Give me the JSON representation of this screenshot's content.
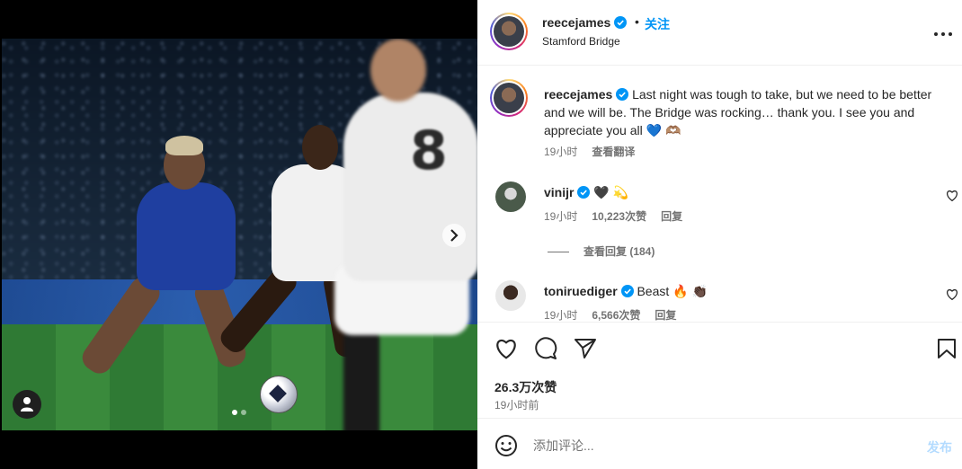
{
  "post": {
    "username": "reecejames",
    "follow_label": "关注",
    "dot": "•",
    "location": "Stamford Bridge"
  },
  "photo": {
    "jersey_number": "8",
    "carousel_current": 1,
    "carousel_total": 2
  },
  "caption": {
    "username": "reecejames",
    "text": "Last night was tough to take, but we need to be better and we will be. The Bridge was rocking… thank you. I see you and appreciate you all 💙 🫶🏽",
    "time": "19小时",
    "translate_label": "查看翻译"
  },
  "comments": [
    {
      "username": "vinijr",
      "text": "🖤 💫",
      "time": "19小时",
      "likes": "10,223次赞",
      "reply_label": "回复",
      "view_replies": "查看回复 (184)"
    },
    {
      "username": "toniruediger",
      "text": "Beast 🔥 👏🏿",
      "time": "19小时",
      "likes": "6,566次赞",
      "reply_label": "回复"
    }
  ],
  "actions": {
    "likes": "26.3万次赞",
    "time": "19小时前"
  },
  "add_comment": {
    "placeholder": "添加评论...",
    "post_label": "发布"
  },
  "colors": {
    "accent": "#0095f6",
    "verified": "#0095f6",
    "post_disabled": "#b3dbff"
  }
}
